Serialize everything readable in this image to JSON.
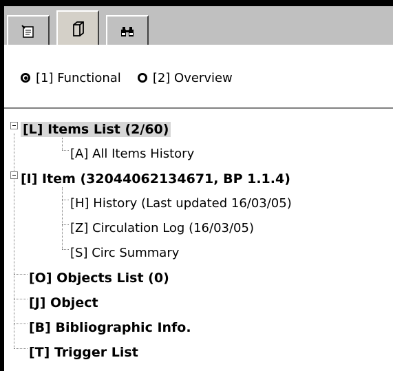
{
  "tabs": [
    {
      "icon": "notepad-icon"
    },
    {
      "icon": "document-icon"
    },
    {
      "icon": "binoculars-icon"
    }
  ],
  "view_mode": {
    "options": [
      {
        "label": "[1] Functional",
        "selected": true
      },
      {
        "label": "[2] Overview",
        "selected": false
      }
    ]
  },
  "tree": {
    "items_list": "[L] Items List (2/60)",
    "all_items_history": "[A] All Items History",
    "item": "[I] Item (32044062134671, BP 1.1.4)",
    "history": "[H] History (Last updated 16/03/05)",
    "circulation_log": "[Z] Circulation Log (16/03/05)",
    "circ_summary": "[S] Circ Summary",
    "objects_list": "[O] Objects List (0)",
    "object": "[J] Object",
    "bibliographic_info": "[B] Bibliographic Info.",
    "trigger_list": "[T] Trigger List"
  }
}
